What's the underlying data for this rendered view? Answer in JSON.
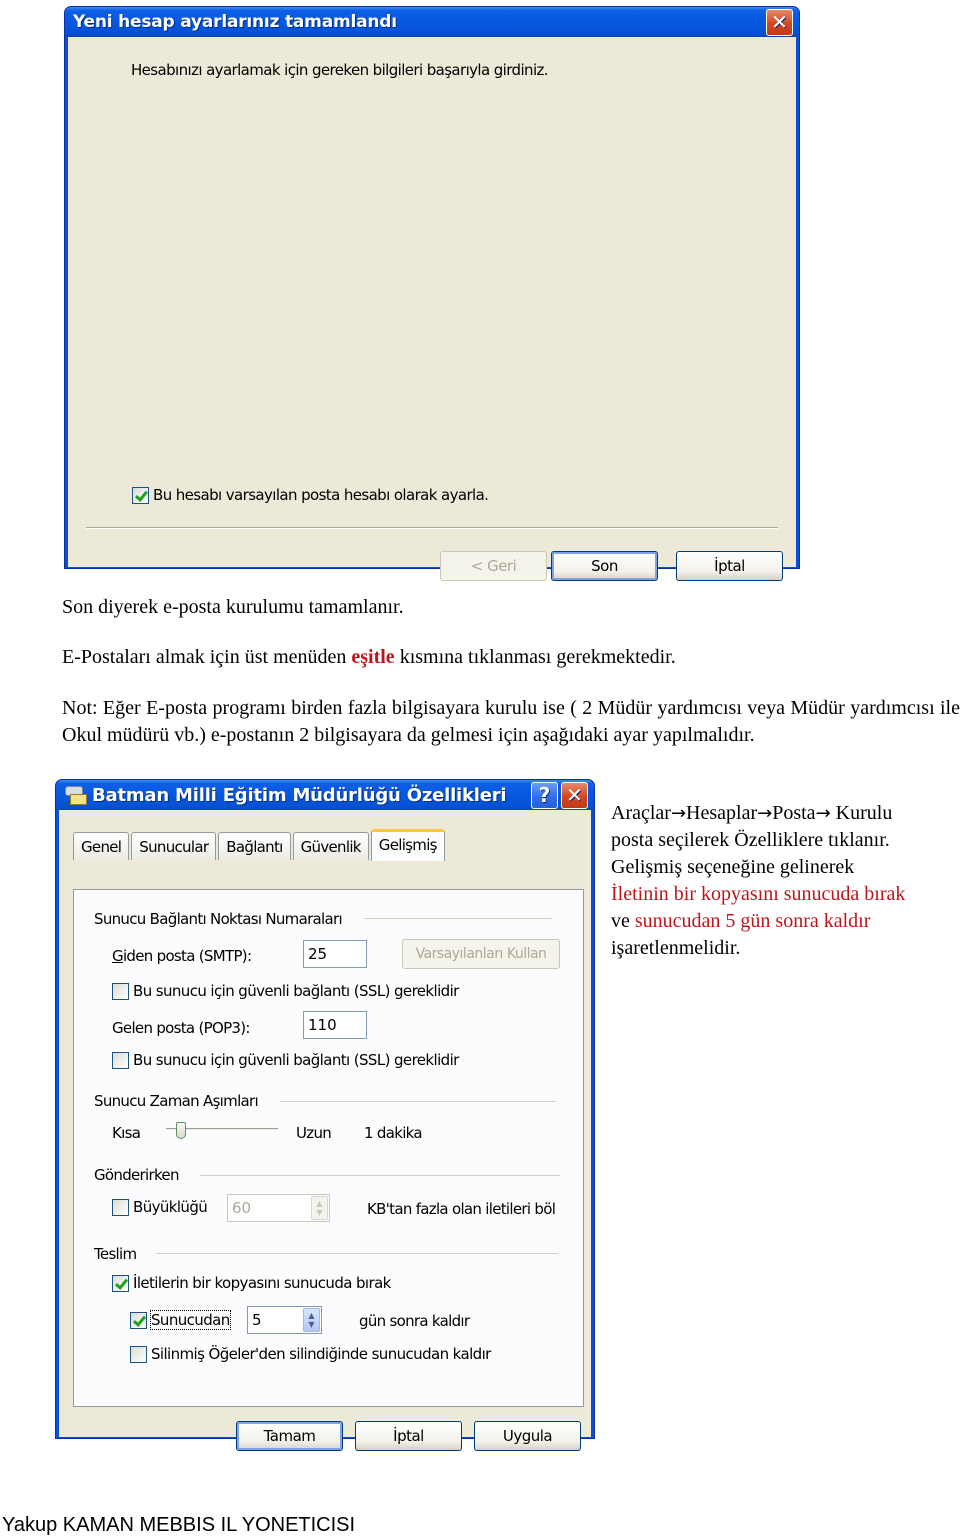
{
  "dialog_finish": {
    "title": "Yeni hesap ayarlarınız tamamlandı",
    "info": "Hesabınızı ayarlamak için gereken bilgileri başarıyla girdiniz.",
    "default_account_checkbox": {
      "label": "Bu hesabı varsayılan posta hesabı olarak ayarla.",
      "checked": true
    },
    "buttons": {
      "back": "< Geri",
      "finish": "Son",
      "cancel": "İptal"
    },
    "close_icon": "close-icon"
  },
  "document": {
    "p1": "Son diyerek e-posta kurulumu tamamlanır.",
    "p2_before": "E-Postaları almak için üst menüden ",
    "p2_highlight": "eşitle",
    "p2_after": " kısmına tıklanması gerekmektedir.",
    "p3": "Not: Eğer E-posta programı birden fazla bilgisayara kurulu ise ( 2 Müdür yardımcısı veya Müdür yardımcısı ile Okul müdürü vb.)  e-postanın 2 bilgisayara da gelmesi için aşağıdaki ayar yapılmalıdır.",
    "p4": {
      "path": [
        "Araçlar",
        "Hesaplar",
        "Posta",
        " Kurulu"
      ],
      "arrow": "→",
      "line2": "posta seçilerek Özelliklere tıklanır.",
      "line3": "Gelişmiş seçeneğine gelinerek",
      "red1": "İletinin bir kopyasını sunucuda bırak",
      "ve": "ve ",
      "red2": "sunucudan 5 gün sonra kaldır",
      "end": "işaretlenmelidir."
    },
    "highlight_color": "#c0141b"
  },
  "dialog_props": {
    "title": "Batman Milli Eğitim Müdürlüğü Özellikleri",
    "tabs": [
      {
        "label": "Genel",
        "active": false
      },
      {
        "label": "Sunucular",
        "active": false
      },
      {
        "label": "Bağlantı",
        "active": false
      },
      {
        "label": "Güvenlik",
        "active": false
      },
      {
        "label": "Gelişmiş",
        "active": true
      }
    ],
    "ports_group": "Sunucu Bağlantı Noktası Numaraları",
    "smtp_label": "Giden posta (SMTP):",
    "smtp_value": "25",
    "use_defaults": "Varsayılanları Kullan",
    "smtp_ssl": {
      "label": "Bu sunucu için güvenli bağlantı (SSL) gereklidir",
      "checked": false
    },
    "pop3_label": "Gelen posta (POP3):",
    "pop3_value": "110",
    "pop3_ssl": {
      "label": "Bu sunucu için güvenli bağlantı (SSL) gereklidir",
      "checked": false
    },
    "timeout_group": "Sunucu Zaman Aşımları",
    "timeout_short": "Kısa",
    "timeout_long": "Uzun",
    "timeout_value": "1 dakika",
    "timeout_slider_fraction": 0.1,
    "sending_group": "Gönderirken",
    "split_checkbox": {
      "label": "Büyüklüğü",
      "checked": false
    },
    "split_value": "60",
    "split_suffix": "KB'tan fazla olan iletileri böl",
    "delivery_group": "Teslim",
    "leave_copy": {
      "label": "İletilerin bir kopyasını sunucuda bırak",
      "checked": true
    },
    "remove_after": {
      "label": "Sunucudan",
      "checked": true
    },
    "remove_days": "5",
    "remove_suffix": "gün sonra kaldır",
    "remove_deleted": {
      "label": "Silinmiş Öğeler'den silindiğinde sunucudan kaldır",
      "checked": false
    },
    "buttons": {
      "ok": "Tamam",
      "cancel": "İptal",
      "apply": "Uygula"
    }
  },
  "footer": "Yakup KAMAN MEBBIS IL YONETICISI"
}
